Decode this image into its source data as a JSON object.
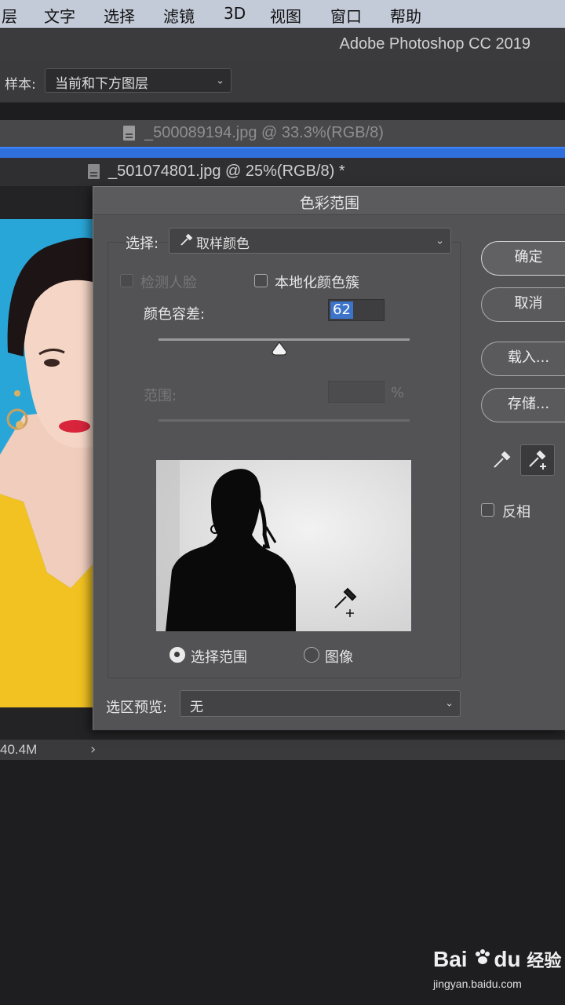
{
  "menubar": {
    "items": [
      "图层",
      "文字",
      "选择",
      "滤镜",
      "3D",
      "视图",
      "窗口",
      "帮助"
    ],
    "first_visible": "层"
  },
  "app": {
    "title": "Adobe Photoshop CC 2019"
  },
  "options_bar": {
    "sample_label": "样本:",
    "sample_value": "当前和下方图层"
  },
  "tabs": [
    {
      "label": "_500089194.jpg @ 33.3%(RGB/8)",
      "active": false
    },
    {
      "label": "_501074801.jpg @ 25%(RGB/8) *",
      "active": true
    }
  ],
  "status": {
    "size": "40.4M",
    "arrow": "›"
  },
  "dialog": {
    "title": "色彩范围",
    "select_label": "选择:",
    "select_value": "取样颜色",
    "detect_faces_label": "检测人脸",
    "detect_faces_checked": false,
    "localized_label": "本地化颜色簇",
    "localized_checked": false,
    "fuzziness_label": "颜色容差:",
    "fuzziness_value": "62",
    "fuzziness_fraction": 0.48,
    "range_label": "范围:",
    "range_unit": "%",
    "radio_selection_label": "选择范围",
    "radio_image_label": "图像",
    "radio_selected": "选择范围",
    "preview_label": "选区预览:",
    "preview_value": "无",
    "buttons": {
      "ok": "确定",
      "cancel": "取消",
      "load": "载入...",
      "save": "存储..."
    },
    "invert_label": "反相",
    "invert_checked": false
  },
  "watermark": {
    "brand_bai": "Bai",
    "brand_du": "du",
    "brand_cn": "经验",
    "url": "jingyan.baidu.com"
  },
  "colors": {
    "accent": "#3a86ff",
    "photo_bg": "#29a6d8",
    "dress": "#f2c222"
  }
}
